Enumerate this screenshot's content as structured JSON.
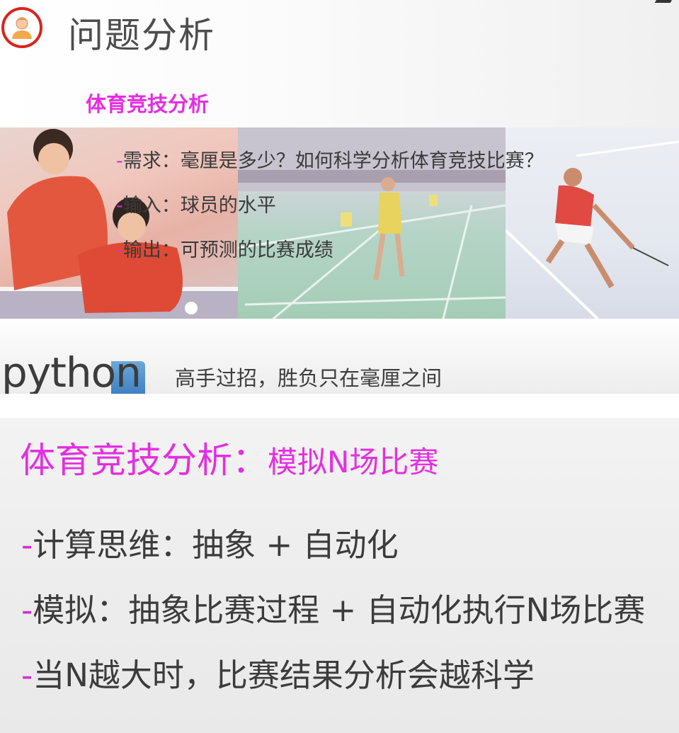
{
  "slide1": {
    "title": "问题分析",
    "subtitle": "体育竞技分析",
    "requirements": [
      {
        "dash": "-",
        "text": "需求：毫厘是多少？如何科学分析体育竞技比赛？"
      },
      {
        "dash": "-",
        "text": "输入：球员的水平"
      },
      {
        "dash": "-",
        "text": "输出：可预测的比赛成绩"
      }
    ],
    "logo_text": "python",
    "tagline": "高手过招，胜负只在毫厘之间",
    "icons": {
      "avatar": "person-avatar-icon"
    },
    "colors": {
      "accent": "#e32fe0",
      "avatar_ring": "#d9241f",
      "python_blue": "#3e7fc2"
    }
  },
  "slide2": {
    "title": "体育竞技分析：",
    "title_tail": "模拟N场比赛",
    "bullets": [
      {
        "dash": "-",
        "text": "计算思维：抽象 + 自动化"
      },
      {
        "dash": "-",
        "text": "模拟：抽象比赛过程 + 自动化执行N场比赛"
      },
      {
        "dash": "-",
        "text": "当N越大时，比赛结果分析会越科学"
      }
    ]
  }
}
